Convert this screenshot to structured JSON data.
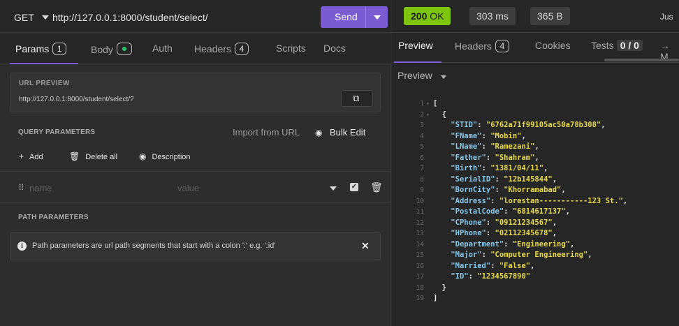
{
  "request": {
    "method": "GET",
    "url": "http://127.0.0.1:8000/student/select/",
    "send_label": "Send"
  },
  "request_tabs": [
    {
      "label": "Params",
      "badge": "1",
      "active": true
    },
    {
      "label": "Body",
      "badge_dot": true,
      "active": false
    },
    {
      "label": "Auth",
      "active": false
    },
    {
      "label": "Headers",
      "badge": "4",
      "active": false
    },
    {
      "label": "Scripts",
      "active": false
    },
    {
      "label": "Docs",
      "active": false
    }
  ],
  "url_preview": {
    "title": "URL PREVIEW",
    "value": "http://127.0.0.1:8000/student/select/?",
    "copy_icon": "copy-icon"
  },
  "query": {
    "title": "QUERY PARAMETERS",
    "import_label": "Import from URL",
    "bulk_edit_label": "Bulk Edit",
    "add_label": "Add",
    "delete_all_label": "Delete all",
    "description_label": "Description",
    "row": {
      "name_placeholder": "name",
      "value_placeholder": "value"
    }
  },
  "path": {
    "title": "PATH PARAMETERS",
    "info": "Path parameters are url path segments that start with a colon ':' e.g. ':id'"
  },
  "response": {
    "status_code": "200",
    "status_text": "OK",
    "time": "303 ms",
    "size": "365 B",
    "truncated_label": "Jus",
    "tabs": [
      {
        "label": "Preview",
        "active": true
      },
      {
        "label": "Headers",
        "badge": "4"
      },
      {
        "label": "Cookies"
      },
      {
        "label": "Tests",
        "count": "0 / 0"
      },
      {
        "label": "→ M"
      }
    ],
    "preview_dropdown": "Preview",
    "status_color": "#7fc40f",
    "accent_color": "#7b5bd1"
  },
  "json_lines": [
    {
      "n": "1",
      "fold": true
    },
    {
      "n": "2",
      "fold": true
    },
    {
      "n": "3",
      "key": "STID",
      "value": "6762a71f99105ac50a78b308"
    },
    {
      "n": "4",
      "key": "FName",
      "value": "Mobin"
    },
    {
      "n": "5",
      "key": "LName",
      "value": "Ramezani"
    },
    {
      "n": "6",
      "key": "Father",
      "value": "Shahram"
    },
    {
      "n": "7",
      "key": "Birth",
      "value": "1381/04/11"
    },
    {
      "n": "8",
      "key": "SerialID",
      "value": "12b145844"
    },
    {
      "n": "9",
      "key": "BornCity",
      "value": "Khorramabad"
    },
    {
      "n": "10",
      "key": "Address",
      "value": "lorestan-----------123 St."
    },
    {
      "n": "11",
      "key": "PostalCode",
      "value": "6814617137"
    },
    {
      "n": "12",
      "key": "CPhone",
      "value": "09121234567"
    },
    {
      "n": "13",
      "key": "HPhone",
      "value": "02112345678"
    },
    {
      "n": "14",
      "key": "Department",
      "value": "Engineering"
    },
    {
      "n": "15",
      "key": "Major",
      "value": "Computer Engineering"
    },
    {
      "n": "16",
      "key": "Married",
      "value": "False"
    },
    {
      "n": "17",
      "key": "ID",
      "value": "1234567890"
    },
    {
      "n": "18"
    },
    {
      "n": "19"
    }
  ]
}
